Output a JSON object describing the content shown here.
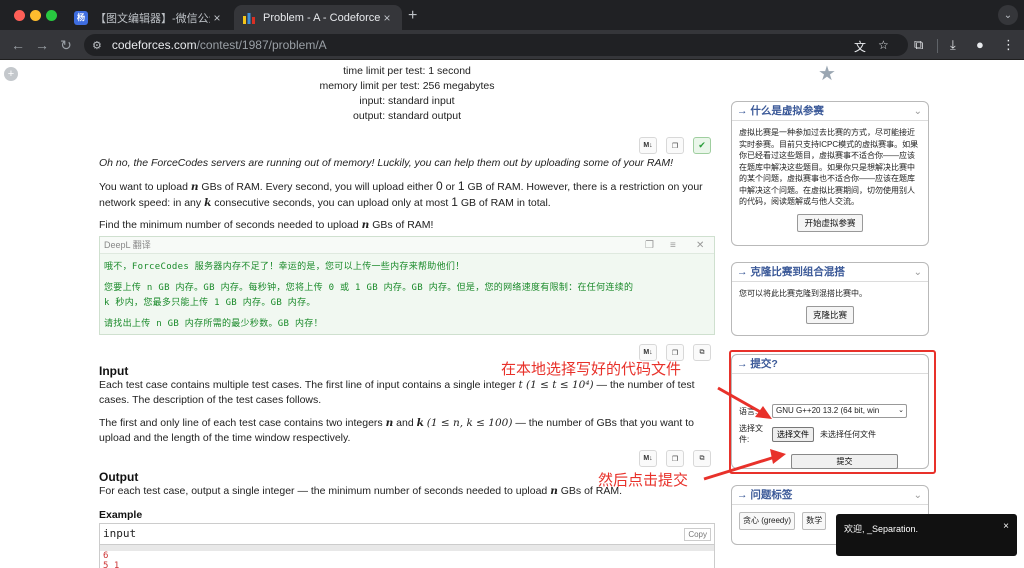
{
  "browser": {
    "tabs": [
      {
        "title": "【图文编辑器】-微信公众号图",
        "favicon": "wechat-editor-favicon",
        "close": "×"
      },
      {
        "title": "Problem - A - Codeforces",
        "favicon": "codeforces-favicon",
        "close": "×"
      }
    ],
    "new_tab": "+",
    "url_host": "codeforces.com",
    "url_path": "/contest/1987/problem/A"
  },
  "problem": {
    "time_limit": "time limit per test: 1 second",
    "memory_limit": "memory limit per test: 256 megabytes",
    "input": "input: standard input",
    "output": "output: standard output",
    "intro": "Oh no, the ForceCodes servers are running out of memory! Luckily, you can help them out by uploading some of your RAM!",
    "p1_a": "You want to upload ",
    "p1_b": " GBs of RAM. Every second, you will upload either ",
    "p1_c": " or ",
    "p1_d": " GB of RAM. However, there is a restriction on your network speed: in any ",
    "p1_e": " consecutive seconds, you can upload only at most ",
    "p1_f": " GB of RAM in total.",
    "p2_a": "Find the minimum number of seconds needed to upload ",
    "p2_b": " GBs of RAM!",
    "var_n": "n",
    "var_k": "k",
    "zero": "0",
    "one": "1",
    "md_label": "M↓",
    "input_title": "Input",
    "input_p1_a": "Each test case contains multiple test cases. The first line of input contains a single integer ",
    "input_p1_b": " — the number of test cases. The description of the test cases follows.",
    "input_t_range": "t (1 ≤ t ≤ 10⁴)",
    "input_p2_a": "The first and only line of each test case contains two integers ",
    "input_p2_b": " and ",
    "input_p2_c": " — the number of GBs that you want to upload and the length of the time window respectively.",
    "input_nk_range": "(1 ≤ n, k ≤ 100)",
    "output_title": "Output",
    "output_p_a": "For each test case, output a single integer — the minimum number of seconds needed to upload ",
    "output_p_b": " GBs of RAM.",
    "example_title": "Example",
    "example_input_label": "input",
    "example_copy": "Copy",
    "example_lines": [
      "6",
      "5 1"
    ]
  },
  "deepl": {
    "header": "DeepL 翻译",
    "lines": [
      "哦不，ForceCodes 服务器内存不足了！幸运的是，您可以上传一些内存来帮助他们！",
      "您要上传 n GB 内存。GB 内存。每秒钟，您将上传 0 或 1 GB 内存。GB 内存。但是，您的网络速度有限制：在任何连续的",
      "k 秒内，您最多只能上传 1 GB 内存。GB 内存。",
      "请找出上传 n GB 内存所需的最少秒数。GB 内存！"
    ]
  },
  "sidebar": {
    "virtual": {
      "title": "→ 什么是虚拟参赛",
      "text": "虚拟比赛是一种参加过去比赛的方式，尽可能接近实时参赛。目前只支持ICPC模式的虚拟赛事。如果你已经看过这些题目，虚拟赛事不适合你——应该在题库中解决这些题目。如果你只是想解决比赛中的某个问题，虚拟赛事也不适合你——应该在题库中解决这个问题。在虚拟比赛期间，切勿使用别人的代码，阅读题解或与他人交流。",
      "button": "开始虚拟参赛"
    },
    "clone": {
      "title": "→ 克隆比赛到组合混搭",
      "text": "您可以将此比赛克隆到混搭比赛中。",
      "button": "克隆比赛"
    },
    "submit": {
      "title": "→ 提交?",
      "lang_label": "语言:",
      "lang_value": "GNU G++20 13.2 (64 bit, win",
      "file_label_1": "选择文",
      "file_label_2": "件:",
      "file_button": "选择文件",
      "file_none": "未选择任何文件",
      "submit_button": "提交"
    },
    "tags": {
      "title": "→ 问题标签",
      "items": [
        "贪心 (greedy)",
        "数学"
      ]
    }
  },
  "annotations": {
    "choose_file": "在本地选择写好的代码文件",
    "then_submit": "然后点击提交",
    "color": "#e8312a"
  },
  "toast": {
    "text": "欢迎, _Separation.",
    "close": "×"
  }
}
